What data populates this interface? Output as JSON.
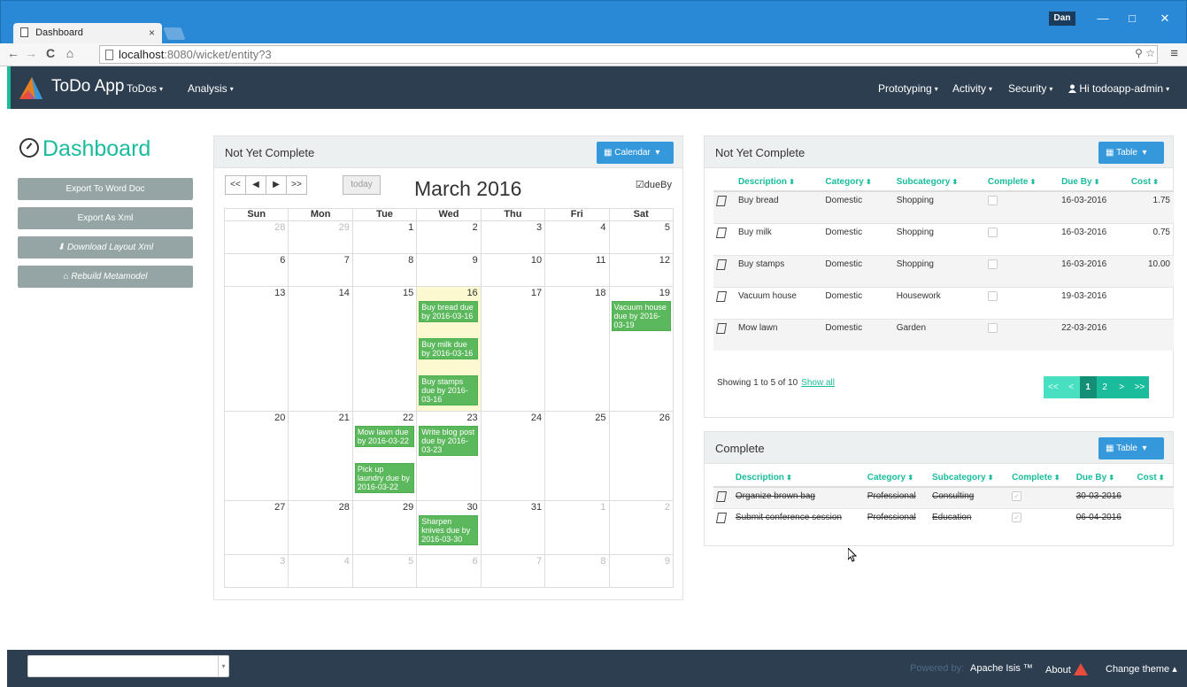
{
  "browser": {
    "tab_title": "Dashboard",
    "tab_close": "×",
    "user": "Dan",
    "win_minimize": "—",
    "win_maximize": "□",
    "win_close": "✕",
    "back": "←",
    "forward": "→",
    "reload": "C",
    "home": "⌂",
    "url_host": "localhost",
    "url_rest": ":8080/wicket/entity?3",
    "zoom": "⚲",
    "star": "☆",
    "menu": "≡"
  },
  "navbar": {
    "brand": "ToDo App",
    "left_menus": [
      "ToDos",
      "Analysis"
    ],
    "right_menus": [
      "Prototyping",
      "Activity",
      "Security"
    ],
    "user_menu": "Hi todoapp-admin",
    "caret": "▾",
    "user_icon": "person-icon"
  },
  "sidebar": {
    "title": "Dashboard",
    "buttons": [
      "Export To Word Doc",
      "Export As Xml",
      "Download Layout Xml",
      "Rebuild Metamodel"
    ],
    "download_icon": "⬇",
    "rebuild_icon": "⌂"
  },
  "calendar_panel": {
    "title": "Not Yet Complete",
    "view_button": "Calendar",
    "view_caret": "▾",
    "prev_year": "<<",
    "prev": "◀",
    "next": "▶",
    "next_year": ">>",
    "today": "today",
    "month": "March 2016",
    "dueby_label": "dueBy",
    "dueby_checked": true,
    "days": [
      "Sun",
      "Mon",
      "Tue",
      "Wed",
      "Thu",
      "Fri",
      "Sat"
    ],
    "weeks": [
      [
        {
          "d": "28",
          "o": true
        },
        {
          "d": "29",
          "o": true
        },
        {
          "d": "1"
        },
        {
          "d": "2"
        },
        {
          "d": "3"
        },
        {
          "d": "4"
        },
        {
          "d": "5"
        }
      ],
      [
        {
          "d": "6"
        },
        {
          "d": "7"
        },
        {
          "d": "8"
        },
        {
          "d": "9"
        },
        {
          "d": "10"
        },
        {
          "d": "11"
        },
        {
          "d": "12"
        }
      ],
      [
        {
          "d": "13"
        },
        {
          "d": "14"
        },
        {
          "d": "15"
        },
        {
          "d": "16",
          "today": true
        },
        {
          "d": "17"
        },
        {
          "d": "18"
        },
        {
          "d": "19"
        }
      ],
      [
        {
          "d": "20"
        },
        {
          "d": "21"
        },
        {
          "d": "22"
        },
        {
          "d": "23"
        },
        {
          "d": "24"
        },
        {
          "d": "25"
        },
        {
          "d": "26"
        }
      ],
      [
        {
          "d": "27"
        },
        {
          "d": "28"
        },
        {
          "d": "29"
        },
        {
          "d": "30"
        },
        {
          "d": "31"
        },
        {
          "d": "1",
          "o": true
        },
        {
          "d": "2",
          "o": true
        }
      ],
      [
        {
          "d": "3",
          "o": true
        },
        {
          "d": "4",
          "o": true
        },
        {
          "d": "5",
          "o": true
        },
        {
          "d": "6",
          "o": true
        },
        {
          "d": "7",
          "o": true
        },
        {
          "d": "8",
          "o": true
        },
        {
          "d": "9",
          "o": true
        }
      ]
    ],
    "events": [
      {
        "week": 2,
        "day": 3,
        "text": "Buy bread due by 2016-03-16"
      },
      {
        "week": 2,
        "day": 3,
        "text": "Buy milk due by 2016-03-16"
      },
      {
        "week": 2,
        "day": 3,
        "text": "Buy stamps due by 2016-03-16"
      },
      {
        "week": 2,
        "day": 6,
        "text": "Vacuum house due by 2016-03-19"
      },
      {
        "week": 3,
        "day": 2,
        "text": "Mow lawn due by 2016-03-22"
      },
      {
        "week": 3,
        "day": 2,
        "text": "Pick up laundry due by 2016-03-22"
      },
      {
        "week": 3,
        "day": 3,
        "text": "Write blog post due by 2016-03-23"
      },
      {
        "week": 4,
        "day": 3,
        "text": "Sharpen knives due by 2016-03-30"
      }
    ]
  },
  "table_panel": {
    "title": "Not Yet Complete",
    "view_button": "Table",
    "view_caret": "▾",
    "headers": [
      "Description",
      "Category",
      "Subcategory",
      "Complete",
      "Due By",
      "Cost"
    ],
    "rows": [
      {
        "description": "Buy bread",
        "category": "Domestic",
        "subcategory": "Shopping",
        "due": "16-03-2016",
        "cost": "1.75"
      },
      {
        "description": "Buy milk",
        "category": "Domestic",
        "subcategory": "Shopping",
        "due": "16-03-2016",
        "cost": "0.75"
      },
      {
        "description": "Buy stamps",
        "category": "Domestic",
        "subcategory": "Shopping",
        "due": "16-03-2016",
        "cost": "10.00"
      },
      {
        "description": "Vacuum house",
        "category": "Domestic",
        "subcategory": "Housework",
        "due": "19-03-2016",
        "cost": ""
      },
      {
        "description": "Mow lawn",
        "category": "Domestic",
        "subcategory": "Garden",
        "due": "22-03-2016",
        "cost": ""
      }
    ],
    "showing": "Showing 1 to 5 of 10",
    "show_all": "Show all",
    "pager": [
      "<<",
      "<",
      "1",
      "2",
      ">",
      ">>"
    ]
  },
  "complete_panel": {
    "title": "Complete",
    "view_button": "Table",
    "view_caret": "▾",
    "headers": [
      "Description",
      "Category",
      "Subcategory",
      "Complete",
      "Due By",
      "Cost"
    ],
    "rows": [
      {
        "description": "Organize brown bag",
        "category": "Professional",
        "subcategory": "Consulting",
        "due": "30-03-2016",
        "cost": ""
      },
      {
        "description": "Submit conference session",
        "category": "Professional",
        "subcategory": "Education",
        "due": "06-04-2016",
        "cost": ""
      }
    ]
  },
  "footer": {
    "powered": "Powered by:",
    "apache": "Apache Isis ™",
    "about": "About",
    "theme": "Change theme",
    "caret": "▴"
  },
  "colors": {
    "accent": "#1abc9c",
    "navbar": "#2c3e50",
    "blue_button": "#3498db",
    "event": "#5cb85c",
    "today": "#fcf8cf"
  }
}
